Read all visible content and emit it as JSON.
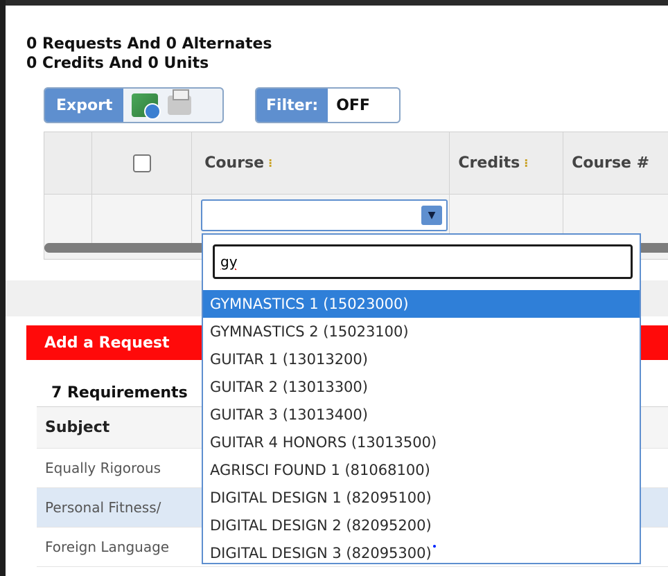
{
  "summary": {
    "line1": "0 Requests And 0 Alternates",
    "line2": "0 Credits And 0 Units"
  },
  "toolbar": {
    "export_label": "Export",
    "filter_label": "Filter:",
    "filter_value": "OFF"
  },
  "grid": {
    "headers": [
      "Course",
      "Credits",
      "Course #"
    ],
    "sort_glyph": "⁝"
  },
  "combo": {
    "value": ""
  },
  "dropdown": {
    "search_value": "gy",
    "options": [
      "GYMNASTICS 1 (15023000)",
      "GYMNASTICS 2 (15023100)",
      "GUITAR 1 (13013200)",
      "GUITAR 2 (13013300)",
      "GUITAR 3 (13013400)",
      "GUITAR 4 HONORS (13013500)",
      "AGRISCI FOUND 1 (81068100)",
      "DIGITAL DESIGN 1 (82095100)",
      "DIGITAL DESIGN 2 (82095200)",
      "DIGITAL DESIGN 3 (82095300)"
    ],
    "selected_index": 0
  },
  "add_request": {
    "label": "Add a Request"
  },
  "requirements": {
    "count_label": "7 Requirements",
    "header": "Subject",
    "rows": [
      "Equally Rigorous",
      "Personal Fitness/",
      "Foreign Language"
    ]
  },
  "colors": {
    "accent": "#5e8fcf",
    "selected": "#2f7fd8",
    "danger": "#ff0a0a"
  }
}
